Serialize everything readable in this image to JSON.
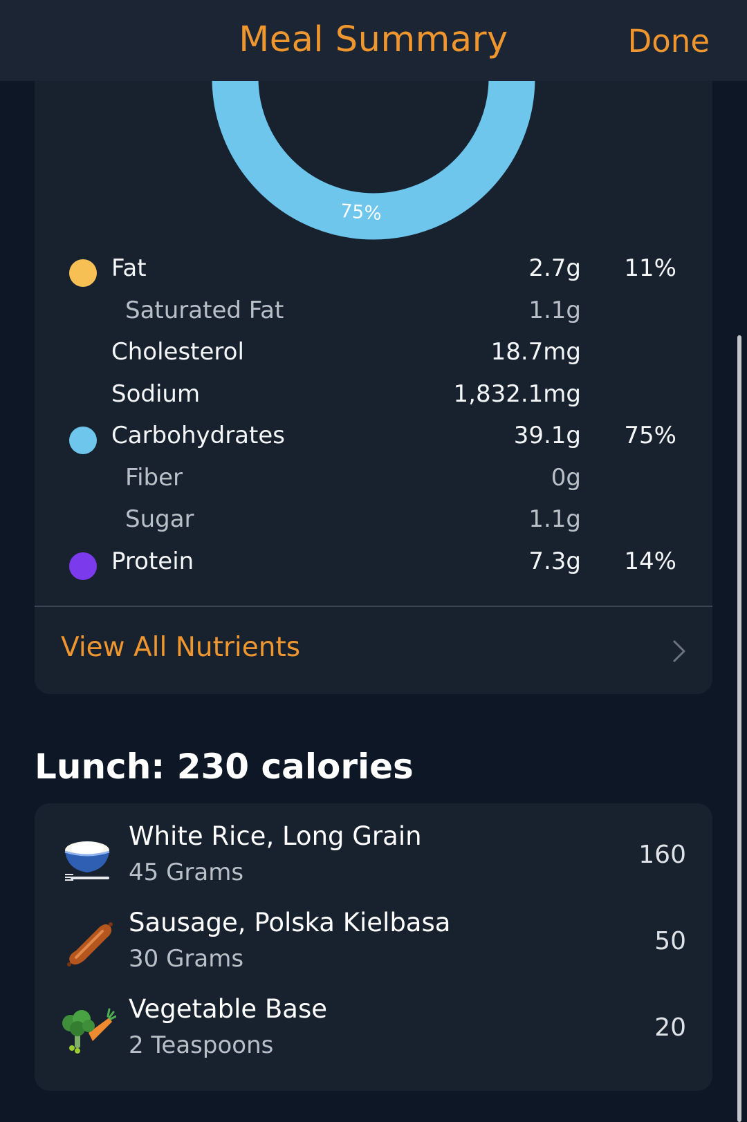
{
  "header": {
    "title": "Meal Summary",
    "done_label": "Done"
  },
  "donut": {
    "label": "75%",
    "carbs_fraction": 0.75,
    "color": "#6ec6ec"
  },
  "macros": [
    {
      "label": "Fat",
      "value": "2.7g",
      "percent": "11%",
      "dot_color": "#f6c055"
    },
    {
      "label": "Saturated Fat",
      "value": "1.1g",
      "sub": true
    },
    {
      "label": "Cholesterol",
      "value": "18.7mg"
    },
    {
      "label": "Sodium",
      "value": "1,832.1mg"
    },
    {
      "label": "Carbohydrates",
      "value": "39.1g",
      "percent": "75%",
      "dot_color": "#6ec6ec"
    },
    {
      "label": "Fiber",
      "value": "0g",
      "sub": true
    },
    {
      "label": "Sugar",
      "value": "1.1g",
      "sub": true
    },
    {
      "label": "Protein",
      "value": "7.3g",
      "percent": "14%",
      "dot_color": "#7c3aed"
    }
  ],
  "view_all": {
    "label": "View All Nutrients"
  },
  "meal": {
    "title": "Lunch: 230 calories",
    "items": [
      {
        "name": "White Rice, Long Grain",
        "amount": "45 Grams",
        "calories": "160",
        "icon": "rice-bowl-icon"
      },
      {
        "name": "Sausage, Polska Kielbasa",
        "amount": "30 Grams",
        "calories": "50",
        "icon": "sausage-icon"
      },
      {
        "name": "Vegetable Base",
        "amount": "2 Teaspoons",
        "calories": "20",
        "icon": "vegetables-icon"
      }
    ]
  },
  "colors": {
    "accent": "#f0962f",
    "background": "#0e1726",
    "card": "#18222f"
  }
}
